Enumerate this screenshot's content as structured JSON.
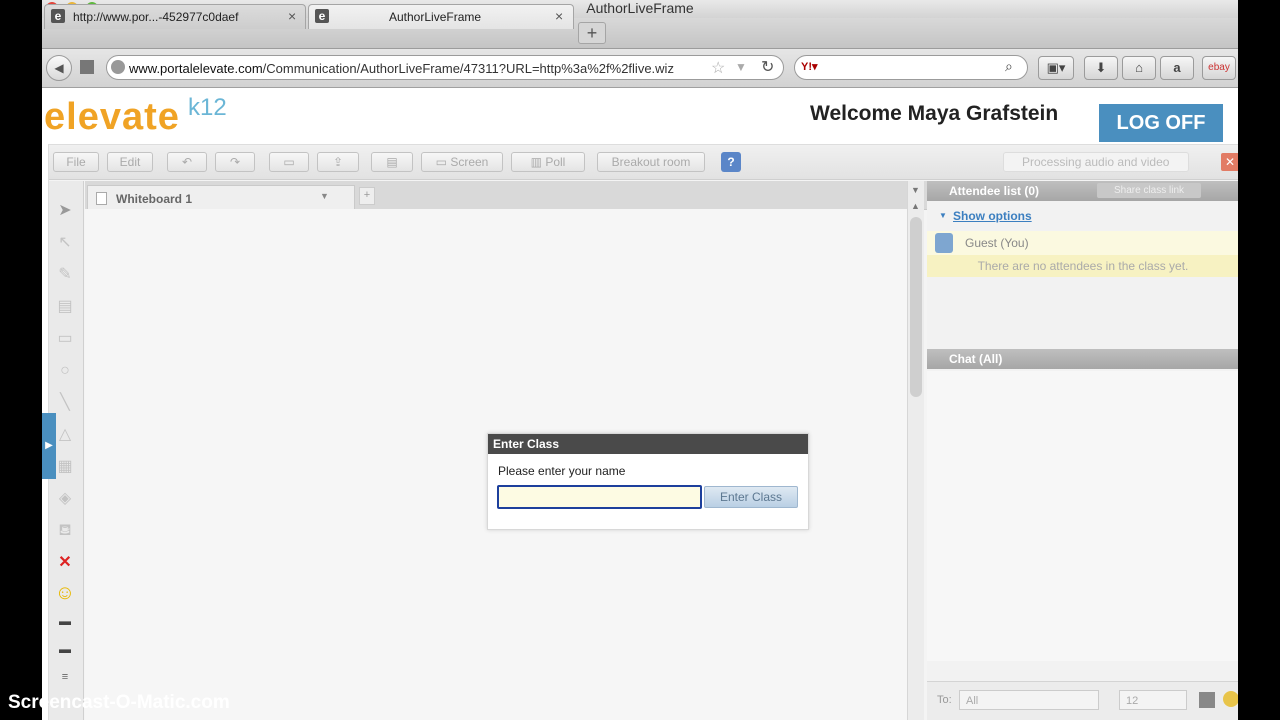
{
  "window": {
    "title": "AuthorLiveFrame"
  },
  "tabs": [
    {
      "label": "http://www.por...-452977c0daef",
      "close": "×"
    },
    {
      "label": "AuthorLiveFrame",
      "close": "×"
    }
  ],
  "newtab_label": "+",
  "navbar": {
    "url_domain": "www.portalelevate.com",
    "url_path": "/Communication/AuthorLiveFrame/47311?URL=http%3a%2f%2flive.wiz",
    "search_placeholder": "",
    "amazon_label": "a",
    "ebay_label": "ebay"
  },
  "header": {
    "logo_text": "elevate",
    "logo_suffix": "k12",
    "welcome": "Welcome Maya Grafstein",
    "logoff": "LOG OFF"
  },
  "app_toolbar": {
    "file": "File",
    "edit": "Edit",
    "screen": "Screen",
    "poll": "Poll",
    "breakout": "Breakout room",
    "help": "?",
    "processing": "Processing audio and video",
    "close": "✕"
  },
  "whiteboard": {
    "tab_title": "Whiteboard 1"
  },
  "attendees": {
    "header": "Attendee list (0)",
    "share_link": "Share class link",
    "show_options": "Show options",
    "guest": "Guest (You)",
    "empty": "There are no attendees in the class yet."
  },
  "chat": {
    "header": "Chat (All)",
    "to_label": "To:",
    "to_value": "All",
    "font_size": "12"
  },
  "dialog": {
    "title": "Enter Class",
    "prompt": "Please enter your name",
    "input_value": "",
    "button": "Enter Class"
  },
  "watermark": "Screencast-O-Matic.com",
  "colors": {
    "brand_orange": "#f0a325",
    "brand_blue": "#4a8fbf",
    "dialog_header": "#4a4a4a",
    "input_border": "#1d3f9c"
  }
}
